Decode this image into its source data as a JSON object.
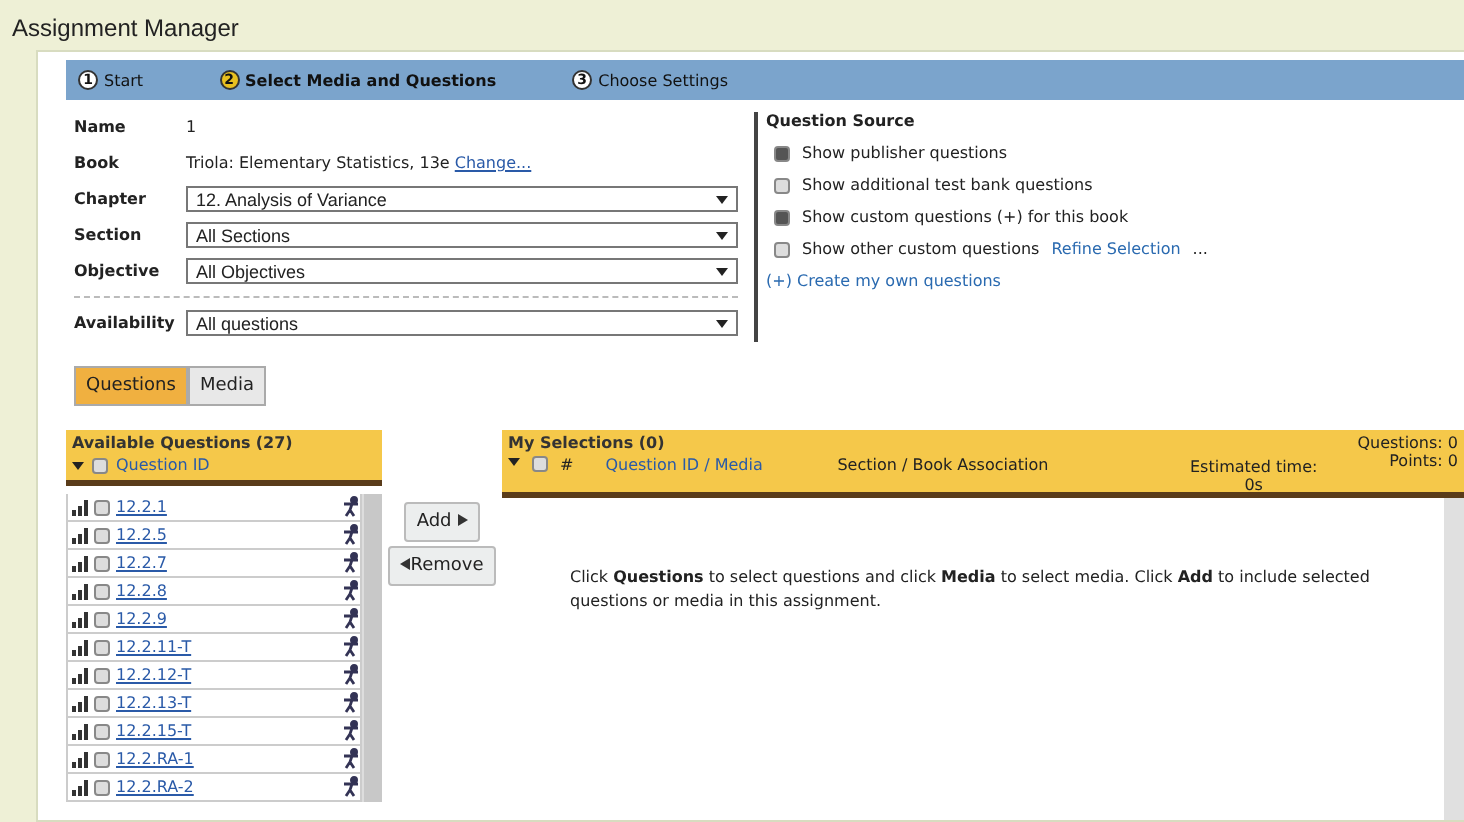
{
  "window": {
    "title": "Assignment Manager"
  },
  "steps": [
    {
      "number": "1",
      "label": "Start",
      "selected": false
    },
    {
      "number": "2",
      "label": "Select Media and Questions",
      "selected": true
    },
    {
      "number": "3",
      "label": "Choose Settings",
      "selected": false
    }
  ],
  "form": {
    "name": {
      "label": "Name",
      "value": "1"
    },
    "book": {
      "label": "Book",
      "value": "Triola: Elementary Statistics, 13e",
      "link": "Change..."
    },
    "selects": [
      {
        "label": "Chapter",
        "value": "12. Analysis of Variance"
      },
      {
        "label": "Section",
        "value": "All Sections"
      },
      {
        "label": "Objective",
        "value": "All Objectives"
      }
    ],
    "availability": {
      "label": "Availability",
      "value": "All questions"
    }
  },
  "question_source": {
    "title": "Question Source",
    "options": [
      {
        "label": "Show publisher questions",
        "checked": true
      },
      {
        "label": "Show additional test bank questions",
        "checked": false
      },
      {
        "label": "Show custom questions (+) for this book",
        "checked": true
      },
      {
        "label": "Show other custom questions",
        "link": "Refine Selection",
        "suffix": "...",
        "checked": false
      }
    ],
    "create_link": "(+) Create my own questions"
  },
  "tabs": [
    {
      "label": "Questions",
      "selected": true
    },
    {
      "label": "Media",
      "selected": false
    }
  ],
  "available": {
    "title": "Available Questions",
    "count": "(27)",
    "column": "Question ID",
    "all_checked": false,
    "rows": [
      {
        "id": "12.2.1",
        "checked": false
      },
      {
        "id": "12.2.5",
        "checked": false
      },
      {
        "id": "12.2.7",
        "checked": false
      },
      {
        "id": "12.2.8",
        "checked": false
      },
      {
        "id": "12.2.9",
        "checked": false
      },
      {
        "id": "12.2.11-T",
        "checked": false
      },
      {
        "id": "12.2.12-T",
        "checked": false
      },
      {
        "id": "12.2.13-T",
        "checked": false
      },
      {
        "id": "12.2.15-T",
        "checked": false
      },
      {
        "id": "12.2.RA-1",
        "checked": false
      },
      {
        "id": "12.2.RA-2",
        "checked": false
      }
    ]
  },
  "buttons": {
    "add": "Add",
    "remove": "Remove"
  },
  "selections": {
    "title": "My Selections (0)",
    "all_checked": false,
    "columns": [
      "#",
      "Question ID / Media",
      "Section / Book Association"
    ],
    "estimated_label": "Estimated time:",
    "estimated_value": "0s",
    "questions": "Questions: 0",
    "points": "Points: 0",
    "message": "Click **Questions** to select questions and click **Media** to select media. Click **Add** to include selected questions or media in this assignment."
  }
}
